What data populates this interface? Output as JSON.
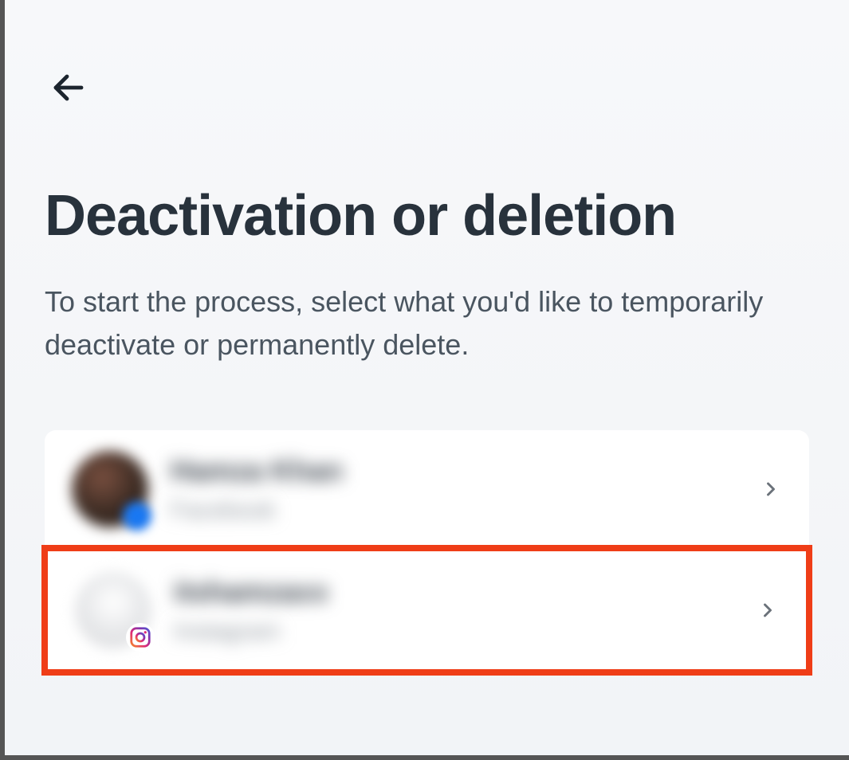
{
  "header": {
    "back_label": "Back"
  },
  "title": "Deactivation or deletion",
  "subtitle": "To start the process, select what you'd like to temporarily deactivate or permanently delete.",
  "accounts": [
    {
      "name": "Hamza Khan",
      "platform": "Facebook",
      "highlighted": false
    },
    {
      "name": "itshamzaxx",
      "platform": "Instagram",
      "highlighted": true
    }
  ]
}
